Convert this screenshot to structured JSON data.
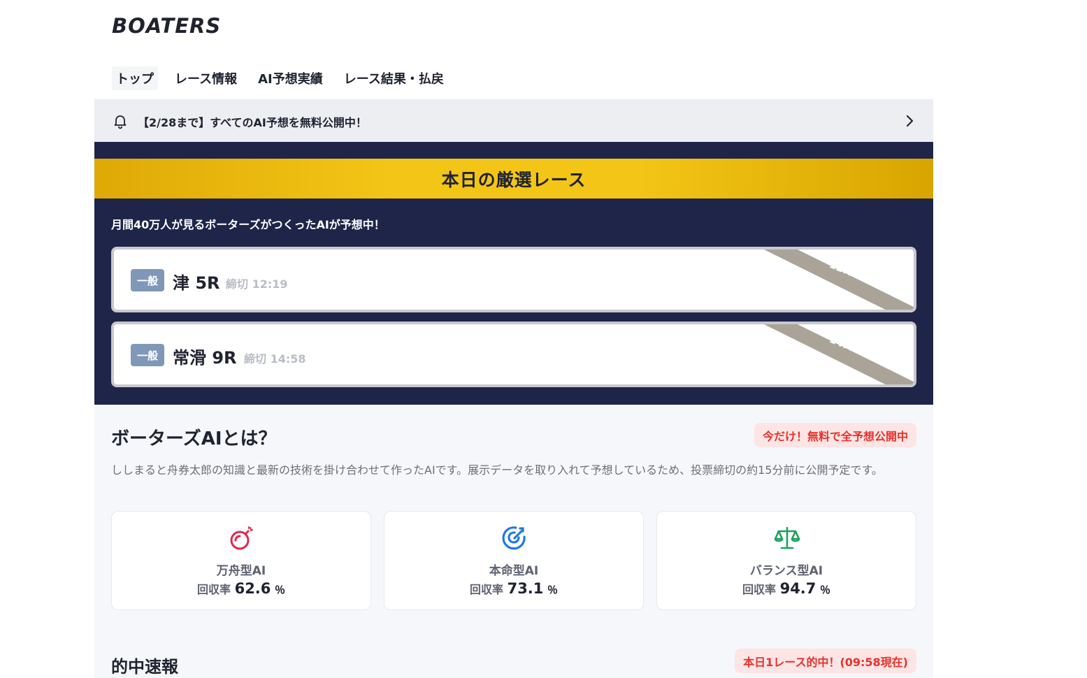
{
  "brand": {
    "logo_text": "BOATERS"
  },
  "nav": {
    "items": [
      {
        "label": "トップ"
      },
      {
        "label": "レース情報"
      },
      {
        "label": "AI予想実績"
      },
      {
        "label": "レース結果・払戻"
      }
    ]
  },
  "notice": {
    "text": "【2/28まで】すべてのAI予想を無料公開中！",
    "icon": "bell-icon",
    "arrow_icon": "chevron-right-icon"
  },
  "featured": {
    "title": "本日の厳選レース",
    "subtitle": "月間40万人が見るボーターズがつくったAIが予想中！",
    "races": [
      {
        "grade": "一般",
        "name": "津 5R",
        "deadline": "締切 12:19",
        "release": "12:04~公開予定"
      },
      {
        "grade": "一般",
        "name": "常滑 9R",
        "deadline": "締切 14:58",
        "release": "14:43~公開予定"
      }
    ]
  },
  "about": {
    "title": "ボーターズAIとは？",
    "badge": "今だけ！無料で全予想公開中",
    "description": "ししまると舟券太郎の知識と最新の技術を掛け合わせて作ったAIです。展示データを取り入れて予想しているため、投票締切の約15分前に公開予定です。",
    "rate_label": "回収率",
    "percent_sign": "％",
    "cards": [
      {
        "name": "万舟型AI",
        "rate": "62.6",
        "icon": "bomb-icon",
        "color": "#e6244f"
      },
      {
        "name": "本命型AI",
        "rate": "73.1",
        "icon": "target-icon",
        "color": "#1f7ae0"
      },
      {
        "name": "バランス型AI",
        "rate": "94.7",
        "icon": "balance-scale-icon",
        "color": "#1aa35a"
      }
    ]
  },
  "hits": {
    "title": "的中速報",
    "badge": "本日1レース的中！(09:58現在)"
  },
  "colors": {
    "navy": "#1e2549",
    "gold": "#f3c516",
    "badge_red": "#e5322c",
    "grade_blue": "#7f98b8",
    "ribbon_gray": "#a9a497"
  }
}
